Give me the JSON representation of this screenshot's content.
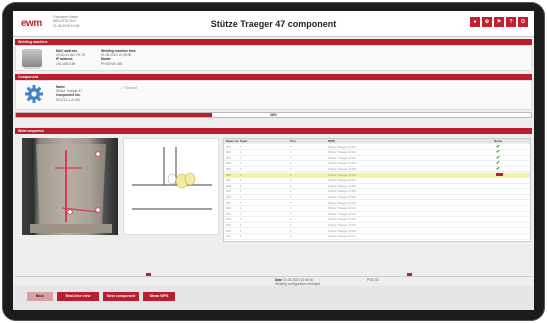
{
  "header": {
    "logo_main": "ewm",
    "user_lines": [
      "Firstname Name",
      "WELDTECH42",
      "01.06.2015 10:45"
    ],
    "title": "Stütze Traeger 47 component",
    "buttons": [
      "",
      "",
      "",
      "",
      ""
    ]
  },
  "welding_machine": {
    "section_label": "Welding machine",
    "machine_caption": "Phoenix Puls",
    "col1": [
      {
        "label": "MAC address",
        "value": "00-80-41-AE-FD-7E"
      },
      {
        "label": "IP address",
        "value": "192.168.0.55"
      }
    ],
    "col2": [
      {
        "label": "Welding machine time",
        "value": "01.06.2015 10:45:30"
      },
      {
        "label": "Model",
        "value": "PHOENIX 355"
      }
    ]
  },
  "component": {
    "section_label": "Component",
    "lines": [
      {
        "label": "Name",
        "value": "Stütze Traeger 47"
      },
      {
        "label": "Component No.",
        "value": "SZ4711-1-A-000"
      }
    ],
    "tag": "Finished",
    "progress_percent": 38,
    "progress_label": "38%"
  },
  "weld_sequence": {
    "section_label": "Weld sequence",
    "columns": [
      "Seam no.",
      "Spec.",
      "Pos.",
      "WPS",
      "Name"
    ],
    "rows": [
      {
        "no": "001",
        "spec": "1",
        "pos": "1",
        "name": "Stütze Traeger 47/01",
        "state": "done"
      },
      {
        "no": "002",
        "spec": "1",
        "pos": "1",
        "name": "Stütze Traeger 47/02",
        "state": "done"
      },
      {
        "no": "003",
        "spec": "1",
        "pos": "1",
        "name": "Stütze Traeger 47/03",
        "state": "done"
      },
      {
        "no": "004",
        "spec": "1",
        "pos": "1",
        "name": "Stütze Traeger 47/04",
        "state": "done"
      },
      {
        "no": "005",
        "spec": "1",
        "pos": "1",
        "name": "Stütze Traeger 47/05",
        "state": "done"
      },
      {
        "no": "006",
        "spec": "1",
        "pos": "1",
        "name": "Stütze Traeger 47/06",
        "state": "active"
      },
      {
        "no": "007",
        "spec": "1",
        "pos": "1",
        "name": "Stütze Traeger 47/07",
        "state": "open"
      },
      {
        "no": "008",
        "spec": "1",
        "pos": "1",
        "name": "Stütze Traeger 47/08",
        "state": "open"
      },
      {
        "no": "009",
        "spec": "1",
        "pos": "1",
        "name": "Stütze Traeger 47/09",
        "state": "open"
      },
      {
        "no": "010",
        "spec": "1",
        "pos": "1",
        "name": "Stütze Traeger 47/10",
        "state": "open"
      },
      {
        "no": "011",
        "spec": "1",
        "pos": "1",
        "name": "Stütze Traeger 47/11",
        "state": "open"
      },
      {
        "no": "012",
        "spec": "1",
        "pos": "1",
        "name": "Stütze Traeger 47/12",
        "state": "open"
      },
      {
        "no": "013",
        "spec": "1",
        "pos": "1",
        "name": "Stütze Traeger 47/13",
        "state": "open"
      },
      {
        "no": "014",
        "spec": "1",
        "pos": "1",
        "name": "Stütze Traeger 47/14",
        "state": "open"
      },
      {
        "no": "015",
        "spec": "1",
        "pos": "1",
        "name": "Stütze Traeger 47/15",
        "state": "open"
      },
      {
        "no": "016",
        "spec": "1",
        "pos": "1",
        "name": "Stütze Traeger 47/16",
        "state": "open"
      },
      {
        "no": "017",
        "spec": "1",
        "pos": "1",
        "name": "Stütze Traeger 47/17",
        "state": "open"
      }
    ]
  },
  "status_bar": {
    "line1_label": "Date",
    "line1_value": "01.06.2015 10:45:30",
    "line2": "Welding configuration changed",
    "right_value": "PNE-35"
  },
  "footer": {
    "back_label": "Back",
    "real_time_label": "Real-time view",
    "next_component_label": "Next component",
    "show_wps_label": "Show WPS"
  },
  "colors": {
    "accent": "#b81f2e",
    "ok": "#2e9a2e",
    "highlight": "#f7f39a"
  }
}
